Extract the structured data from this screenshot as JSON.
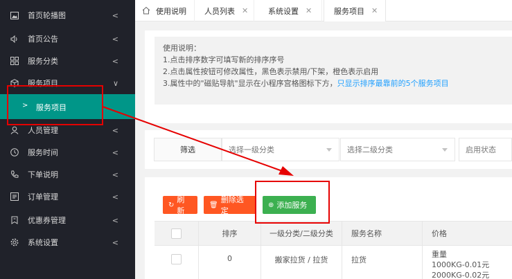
{
  "sidebar": {
    "items": [
      {
        "label": "首页轮播图",
        "icon": "image-icon",
        "chev": "<"
      },
      {
        "label": "首页公告",
        "icon": "speaker-icon",
        "chev": "<"
      },
      {
        "label": "服务分类",
        "icon": "grid-icon",
        "chev": "<"
      },
      {
        "label": "服务项目",
        "icon": "box-icon",
        "chev": "∨"
      },
      {
        "label": "人员管理",
        "icon": "user-icon",
        "chev": "<"
      },
      {
        "label": "服务时间",
        "icon": "clock-icon",
        "chev": "<"
      },
      {
        "label": "下单说明",
        "icon": "phone-icon",
        "chev": "<"
      },
      {
        "label": "订单管理",
        "icon": "list-icon",
        "chev": "<"
      },
      {
        "label": "优惠券管理",
        "icon": "ticket-icon",
        "chev": "<"
      },
      {
        "label": "系统设置",
        "icon": "gear-icon",
        "chev": "<"
      }
    ],
    "sub_item": {
      "arrow": ">",
      "label": "服务项目"
    }
  },
  "tabs": [
    {
      "label": "使用说明",
      "close": ""
    },
    {
      "label": "人员列表",
      "close": "✕"
    },
    {
      "label": "系统设置",
      "close": "✕"
    },
    {
      "label": "服务项目",
      "close": "✕"
    }
  ],
  "notice": {
    "title": "使用说明：",
    "line1": "1.点击排序数字可填写新的排序序号",
    "line2": "2.点击属性按钮可修改属性，黑色表示禁用/下架，橙色表示启用",
    "line3_prefix": "3.属性中的\"磁贴导航\"显示在小程序宫格图标下方，",
    "line3_link": "只显示排序最靠前的5个服务项目"
  },
  "filter": {
    "label": "筛选",
    "select1": "选择一级分类",
    "select2": "选择二级分类",
    "select3": "启用状态"
  },
  "toolbar": {
    "refresh": "刷新",
    "delete": "删除选定",
    "add": "添加服务",
    "refresh_icon": "↻",
    "delete_icon": "🗑",
    "add_icon": "⊕"
  },
  "table": {
    "headers": [
      "排序",
      "一级分类/二级分类",
      "服务名称",
      "价格"
    ],
    "rows": [
      {
        "sort": "0",
        "category": "搬家拉货 / 拉货",
        "name": "拉货",
        "price_lines": [
          "重量",
          "1000KG-0.01元",
          "2000KG-0.02元"
        ]
      }
    ]
  }
}
